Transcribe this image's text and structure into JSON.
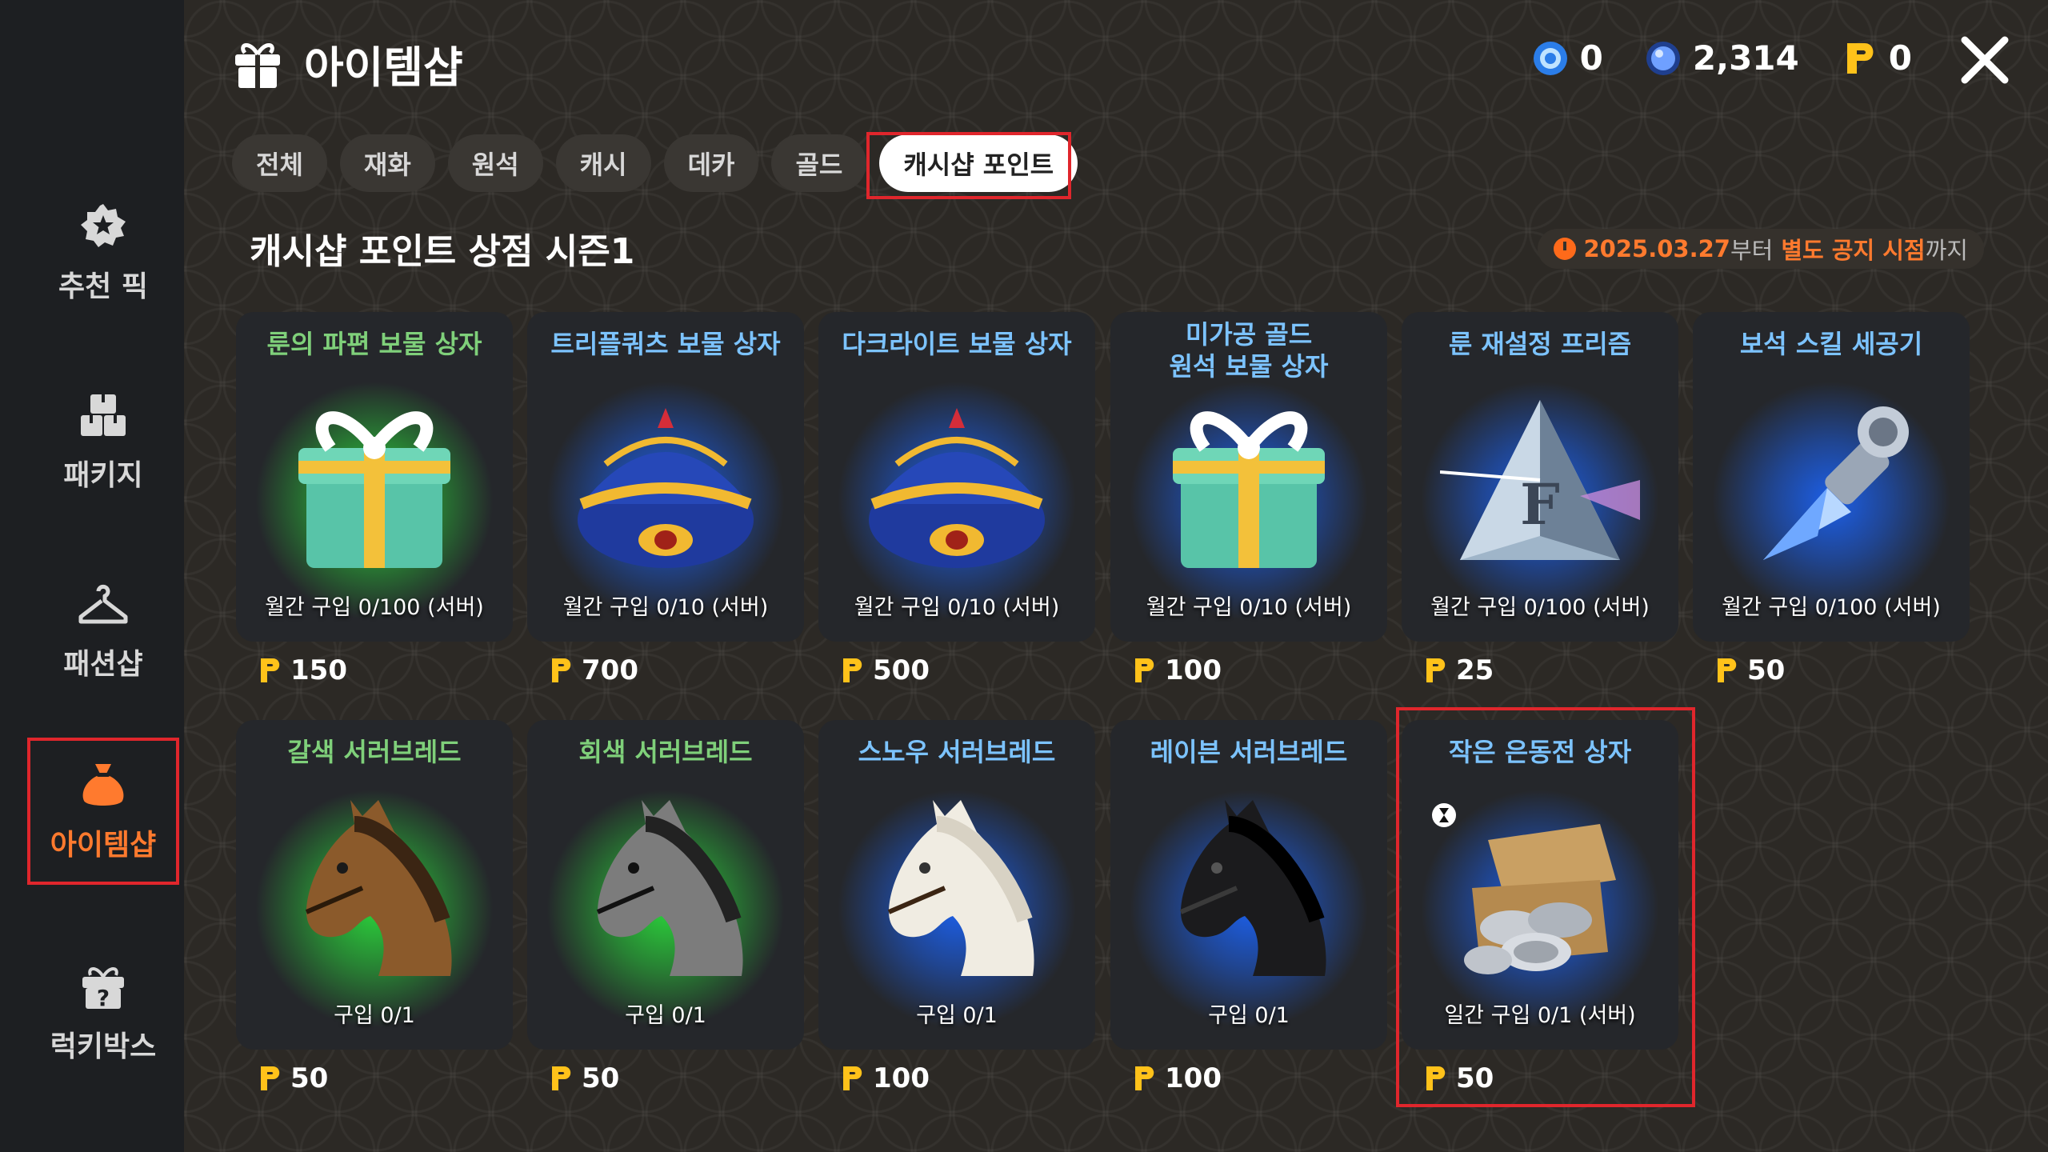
{
  "header": {
    "title": "아이템샵",
    "currencies": [
      {
        "icon": "royal-crystal-icon",
        "value": "0"
      },
      {
        "icon": "blue-crystal-icon",
        "value": "2,314"
      },
      {
        "icon": "p-point-icon",
        "value": "0"
      }
    ]
  },
  "sidebar": {
    "items": [
      {
        "label": "추천 픽",
        "icon": "star-badge-icon"
      },
      {
        "label": "패키지",
        "icon": "package-boxes-icon"
      },
      {
        "label": "패션샵",
        "icon": "hanger-icon"
      },
      {
        "label": "아이템샵",
        "icon": "pouch-icon",
        "active": true
      },
      {
        "label": "럭키박스",
        "icon": "mystery-box-icon"
      }
    ]
  },
  "tabs": [
    "전체",
    "재화",
    "원석",
    "캐시",
    "데카",
    "골드",
    "캐시샵 포인트"
  ],
  "active_tab": "캐시샵 포인트",
  "section": {
    "title": "캐시샵 포인트 상점 시즌1",
    "period_date": "2025.03.27",
    "period_mid": "부터",
    "period_end": "별도 공지 시점",
    "period_tail": "까지"
  },
  "price_symbol": "P",
  "items": [
    {
      "name": "룬의 파편 보물 상자",
      "limit": "월간 구입 0/100 (서버)",
      "price": "150",
      "name_color": "#7fd07a",
      "glow": "#2bd13b",
      "icon": "gift-box-icon"
    },
    {
      "name": "트리플쿼츠 보물 상자",
      "limit": "월간 구입 0/10 (서버)",
      "price": "700",
      "name_color": "#7cc3ff",
      "glow": "#1c5fe8",
      "icon": "treasure-chest-icon"
    },
    {
      "name": "다크라이트 보물 상자",
      "limit": "월간 구입 0/10 (서버)",
      "price": "500",
      "name_color": "#7cc3ff",
      "glow": "#1c5fe8",
      "icon": "treasure-chest-icon"
    },
    {
      "name": "미가공 골드\n원석 보물 상자",
      "limit": "월간 구입 0/10 (서버)",
      "price": "100",
      "name_color": "#7cc3ff",
      "glow": "#1c5fe8",
      "icon": "gift-box-icon"
    },
    {
      "name": "룬 재설정 프리즘",
      "limit": "월간 구입 0/100 (서버)",
      "price": "25",
      "name_color": "#7cc3ff",
      "glow": "#1c5fe8",
      "icon": "prism-icon"
    },
    {
      "name": "보석 스킬 세공기",
      "limit": "월간 구입 0/100 (서버)",
      "price": "50",
      "name_color": "#7cc3ff",
      "glow": "#1c5fe8",
      "icon": "crystal-chisel-icon"
    },
    {
      "name": "갈색 서러브레드",
      "limit": "구입 0/1",
      "price": "50",
      "name_color": "#7fd07a",
      "glow": "#2bd13b",
      "icon": "brown-horse-icon"
    },
    {
      "name": "회색 서러브레드",
      "limit": "구입 0/1",
      "price": "50",
      "name_color": "#7fd07a",
      "glow": "#2bd13b",
      "icon": "gray-horse-icon"
    },
    {
      "name": "스노우 서러브레드",
      "limit": "구입 0/1",
      "price": "100",
      "name_color": "#7cc3ff",
      "glow": "#1c5fe8",
      "icon": "white-horse-icon"
    },
    {
      "name": "레이븐 서러브레드",
      "limit": "구입 0/1",
      "price": "100",
      "name_color": "#7cc3ff",
      "glow": "#1c5fe8",
      "icon": "black-horse-icon"
    },
    {
      "name": "작은 은동전 상자",
      "limit": "일간 구입 0/1 (서버)",
      "price": "50",
      "name_color": "#7cc3ff",
      "glow": "#1c5fe8",
      "icon": "silver-coin-box-icon"
    }
  ],
  "colors": {
    "accent": "#ff7a2e",
    "highlight": "#e0262c",
    "point_yellow": "#ffc21a"
  }
}
